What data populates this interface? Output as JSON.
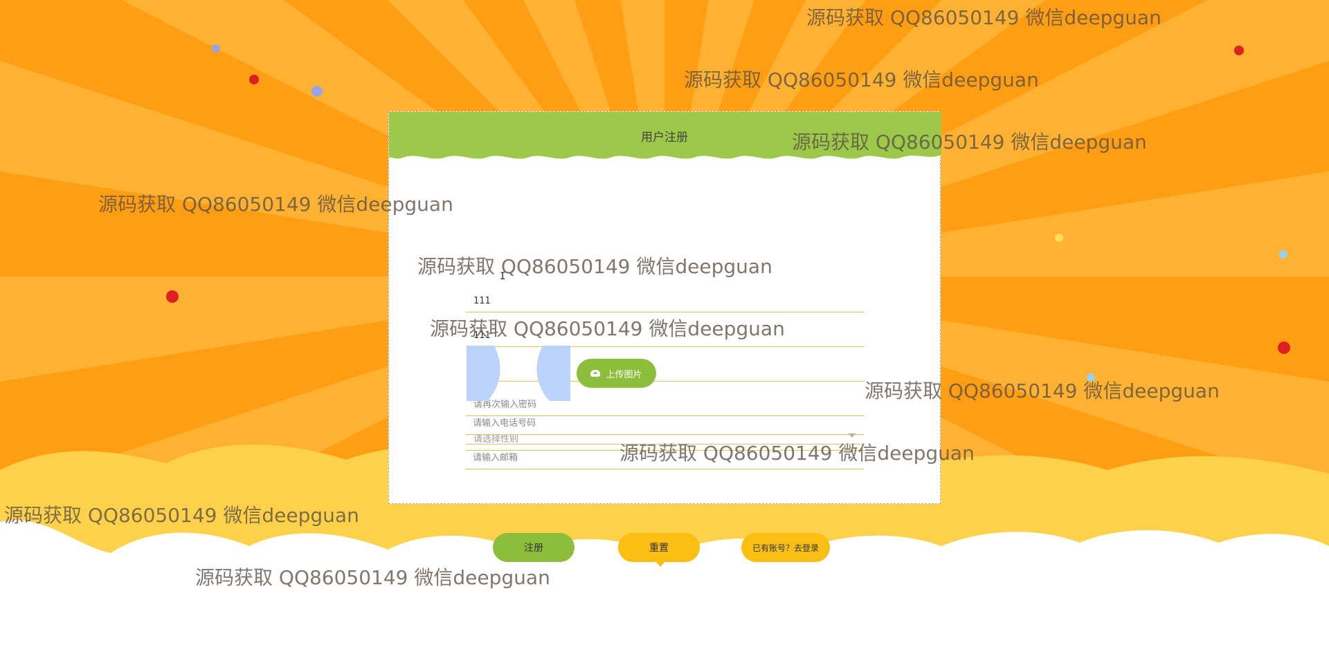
{
  "page": {
    "title": "用户注册"
  },
  "form": {
    "fields": [
      {
        "name": "username",
        "value": "111",
        "placeholder": ""
      },
      {
        "name": "realname",
        "value": "111",
        "placeholder": ""
      },
      {
        "name": "password",
        "value": "...",
        "placeholder": ""
      },
      {
        "name": "password-confirm",
        "value": "",
        "placeholder": "请再次输入密码"
      },
      {
        "name": "gender",
        "value": "请选择性别",
        "placeholder": ""
      },
      {
        "name": "phone",
        "value": "",
        "placeholder": "请输入电话号码"
      },
      {
        "name": "email",
        "value": "",
        "placeholder": "请输入邮箱"
      }
    ],
    "upload_label": "上传图片"
  },
  "actions": {
    "register": "注册",
    "reset": "重置",
    "login": "已有账号？去登录"
  },
  "watermark": {
    "text": "源码获取 QQ86050149 微信deepguan"
  },
  "colors": {
    "header_green": "#9dc94a",
    "button_green": "#8cbd3b",
    "button_yellow": "#fbbf14",
    "bg_orange": "#ff9e12"
  }
}
